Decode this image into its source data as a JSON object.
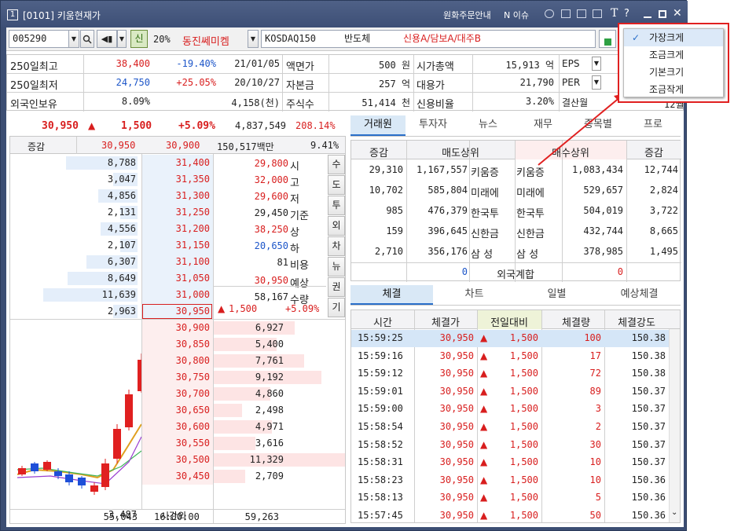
{
  "window": {
    "number": "1",
    "title": "[0101] 키움현재가",
    "right_link1": "원화주문안내",
    "right_link2": "N 이슈"
  },
  "toolbar": {
    "code": "005290",
    "shin": "신",
    "pct": "20%",
    "name": "동진쎄미켐",
    "market": "KOSDAQ150",
    "sector": "반도체",
    "credit": "신용A/담보A/대주B"
  },
  "info": {
    "rows": [
      {
        "l1": "250일최고",
        "v1": "38,400",
        "p1": "-19.40%",
        "d1": "21/01/05",
        "l2": "액면가",
        "v2": "500 원",
        "l3": "시가총액",
        "v3": "15,913 억",
        "l4": "EPS"
      },
      {
        "l1": "250일최저",
        "v1": "24,750",
        "p1": "+25.05%",
        "d1": "20/10/27",
        "l2": "자본금",
        "v2": "257 억",
        "l3": "대용가",
        "v3": "21,790",
        "l4": "PER"
      },
      {
        "l1": "외국인보유",
        "v1": "8.09%",
        "p1": "",
        "d1": "4,158(천)",
        "l2": "주식수",
        "v2": "51,414 천",
        "l3": "신용비율",
        "v3": "3.20%",
        "l4": "결산월"
      }
    ],
    "extra": "12월"
  },
  "quote": {
    "price": "30,950",
    "arrow": "▲",
    "change": "1,500",
    "pct": "+5.09%",
    "volume": "4,837,549",
    "vol_pct": "208.14%",
    "hdr_label": "증감",
    "hdr_p1": "30,950",
    "hdr_p2": "30,900",
    "hdr_amt": "150,517백만",
    "hdr_pct": "9.41%"
  },
  "asks": [
    {
      "qty": "8,788",
      "price": "31,400"
    },
    {
      "qty": "3,047",
      "price": "31,350"
    },
    {
      "qty": "4,856",
      "price": "31,300"
    },
    {
      "qty": "2,131",
      "price": "31,250"
    },
    {
      "qty": "4,556",
      "price": "31,200"
    },
    {
      "qty": "2,107",
      "price": "31,150"
    },
    {
      "qty": "6,307",
      "price": "31,100"
    },
    {
      "qty": "8,649",
      "price": "31,050"
    },
    {
      "qty": "11,639",
      "price": "31,000"
    },
    {
      "qty": "2,963",
      "price": "30,950"
    }
  ],
  "bids": [
    {
      "price": "30,900",
      "qty": "6,927"
    },
    {
      "price": "30,850",
      "qty": "5,400"
    },
    {
      "price": "30,800",
      "qty": "7,761"
    },
    {
      "price": "30,750",
      "qty": "9,192"
    },
    {
      "price": "30,700",
      "qty": "4,860"
    },
    {
      "price": "30,650",
      "qty": "2,498"
    },
    {
      "price": "30,600",
      "qty": "4,971"
    },
    {
      "price": "30,550",
      "qty": "3,616"
    },
    {
      "price": "30,500",
      "qty": "11,329"
    },
    {
      "price": "30,450",
      "qty": "2,709"
    }
  ],
  "stats": [
    {
      "v": "29,800",
      "l": "시"
    },
    {
      "v": "32,000",
      "l": "고"
    },
    {
      "v": "29,600",
      "l": "저"
    },
    {
      "v": "29,450",
      "l": "기준"
    },
    {
      "v": "38,250",
      "l": "상"
    },
    {
      "v": "20,650",
      "l": "하"
    },
    {
      "v": "81",
      "l": "비용"
    },
    {
      "v": "30,950",
      "l": "예상"
    },
    {
      "v": "58,167",
      "l": "수량"
    }
  ],
  "stats_last": {
    "arrow": "▲",
    "chg": "1,500",
    "pct": "+5.09%"
  },
  "side_tabs": [
    "수",
    "도",
    "투",
    "외",
    "차",
    "뉴",
    "권",
    "기"
  ],
  "bottom": {
    "ask_total": "55,043",
    "time": "16:00:00",
    "bid_total": "59,263",
    "after": "3,487",
    "after_label": "시간외"
  },
  "right_tabs": [
    "거래원",
    "투자자",
    "뉴스",
    "재무",
    "종목별",
    "프로"
  ],
  "broker": {
    "headers": [
      "증감",
      "매도상위",
      "매수상위",
      "증감"
    ],
    "rows": [
      {
        "c1": "29,310",
        "q1": "1,167,557",
        "n1": "키움증",
        "n2": "키움증",
        "q2": "1,083,434",
        "c2": "12,744"
      },
      {
        "c1": "10,702",
        "q1": "585,804",
        "n1": "미래에",
        "n2": "미래에",
        "q2": "529,657",
        "c2": "2,824"
      },
      {
        "c1": "985",
        "q1": "476,379",
        "n1": "한국투",
        "n2": "한국투",
        "q2": "504,019",
        "c2": "3,722"
      },
      {
        "c1": "159",
        "q1": "396,645",
        "n1": "신한금",
        "n2": "신한금",
        "q2": "432,744",
        "c2": "8,665"
      },
      {
        "c1": "2,710",
        "q1": "356,176",
        "n1": "삼 성",
        "n2": "삼 성",
        "q2": "378,985",
        "c2": "1,495"
      }
    ],
    "foreign_label": "외국계합",
    "foreign_sell": "0",
    "foreign_buy": "0"
  },
  "trade_tabs": [
    "체결",
    "차트",
    "일별",
    "예상체결"
  ],
  "trades": {
    "headers": [
      "시간",
      "체결가",
      "전일대비",
      "체결량",
      "체결강도"
    ],
    "rows": [
      {
        "t": "15:59:25",
        "p": "30,950",
        "c": "1,500",
        "q": "100",
        "s": "150.38"
      },
      {
        "t": "15:59:16",
        "p": "30,950",
        "c": "1,500",
        "q": "17",
        "s": "150.38"
      },
      {
        "t": "15:59:12",
        "p": "30,950",
        "c": "1,500",
        "q": "72",
        "s": "150.38"
      },
      {
        "t": "15:59:01",
        "p": "30,950",
        "c": "1,500",
        "q": "89",
        "s": "150.37"
      },
      {
        "t": "15:59:00",
        "p": "30,950",
        "c": "1,500",
        "q": "3",
        "s": "150.37"
      },
      {
        "t": "15:58:54",
        "p": "30,950",
        "c": "1,500",
        "q": "2",
        "s": "150.37"
      },
      {
        "t": "15:58:52",
        "p": "30,950",
        "c": "1,500",
        "q": "30",
        "s": "150.37"
      },
      {
        "t": "15:58:31",
        "p": "30,950",
        "c": "1,500",
        "q": "10",
        "s": "150.37"
      },
      {
        "t": "15:58:23",
        "p": "30,950",
        "c": "1,500",
        "q": "10",
        "s": "150.36"
      },
      {
        "t": "15:58:13",
        "p": "30,950",
        "c": "1,500",
        "q": "5",
        "s": "150.36"
      },
      {
        "t": "15:57:45",
        "p": "30,950",
        "c": "1,500",
        "q": "50",
        "s": "150.36"
      }
    ]
  },
  "font_menu": {
    "items": [
      "가장크게",
      "조금크게",
      "기본크기",
      "조금작게"
    ],
    "checked": 0
  }
}
